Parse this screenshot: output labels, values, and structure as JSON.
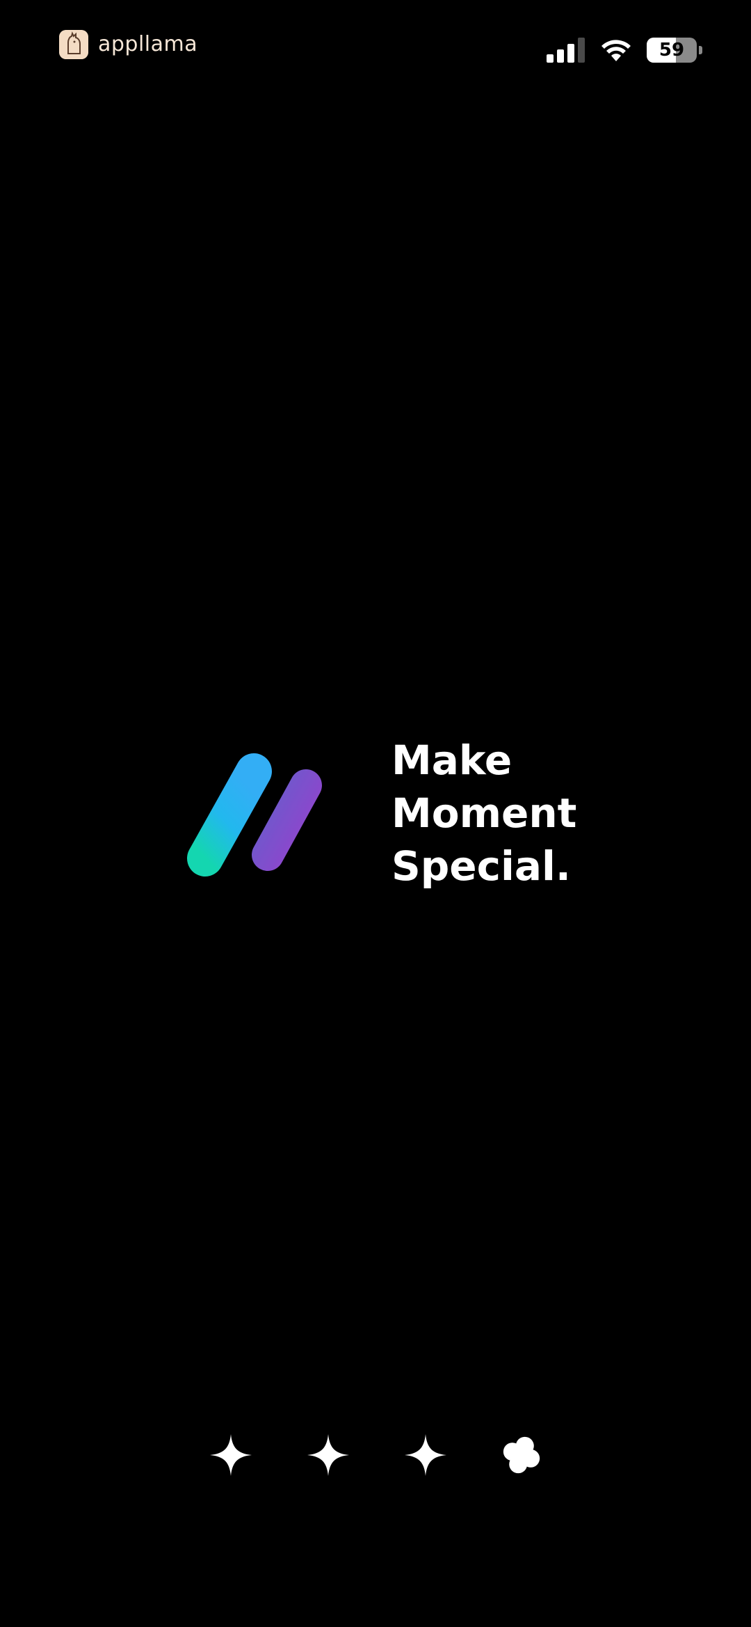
{
  "status_bar": {
    "watermark_text": "appllama",
    "battery_level": "59",
    "battery_percent": 59,
    "icons": [
      "llama-icon",
      "signal-icon",
      "wifi-icon",
      "battery-icon"
    ]
  },
  "brand": {
    "logo": "m-logo-icon",
    "tagline": {
      "line1": "Make",
      "line2": "Moment",
      "line3": "Special."
    },
    "colors": {
      "cyan": "#2ec6f0",
      "teal": "#18d3b3",
      "violet": "#9a6cf2",
      "magenta": "#dc3cf5",
      "pink": "#ff4f9c"
    }
  },
  "loader": {
    "icons": [
      "sparkle-icon",
      "sparkle-icon",
      "sparkle-icon",
      "flower-icon"
    ],
    "color": "#ffffff"
  }
}
